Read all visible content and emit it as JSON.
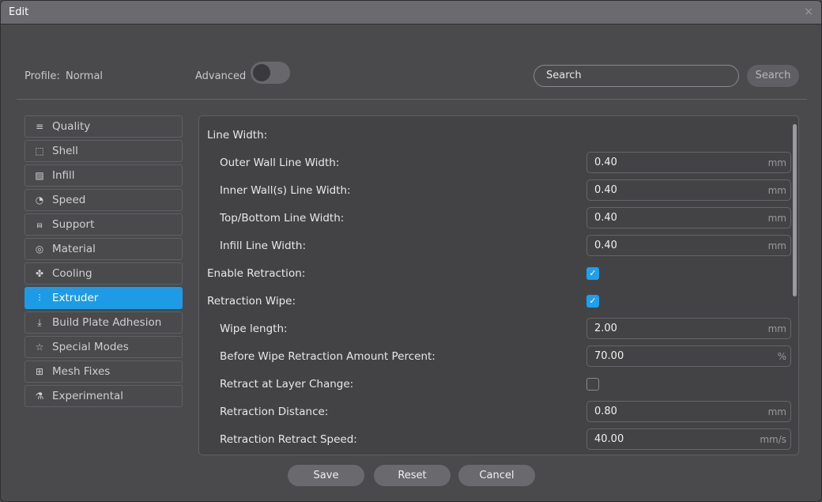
{
  "window": {
    "title": "Edit",
    "close_icon": "×"
  },
  "header": {
    "profile_label": "Profile:",
    "profile_value": "Normal",
    "advanced_label": "Advanced",
    "advanced_on": false,
    "search_placeholder": "Search",
    "search_button": "Search"
  },
  "sidebar": {
    "items": [
      {
        "label": "Quality",
        "icon": "≡"
      },
      {
        "label": "Shell",
        "icon": "⬚"
      },
      {
        "label": "Infill",
        "icon": "▨"
      },
      {
        "label": "Speed",
        "icon": "◔"
      },
      {
        "label": "Support",
        "icon": "⩎"
      },
      {
        "label": "Material",
        "icon": "◎"
      },
      {
        "label": "Cooling",
        "icon": "✤"
      },
      {
        "label": "Extruder",
        "icon": "⫶"
      },
      {
        "label": "Build Plate Adhesion",
        "icon": "⤓"
      },
      {
        "label": "Special Modes",
        "icon": "☆"
      },
      {
        "label": "Mesh Fixes",
        "icon": "⊞"
      },
      {
        "label": "Experimental",
        "icon": "⚗"
      }
    ],
    "active": "Extruder"
  },
  "settings": [
    {
      "label": "Line Width:",
      "type": "header"
    },
    {
      "label": "Outer Wall Line Width:",
      "value": "0.40",
      "unit": "mm"
    },
    {
      "label": "Inner Wall(s) Line Width:",
      "value": "0.40",
      "unit": "mm"
    },
    {
      "label": "Top/Bottom Line Width:",
      "value": "0.40",
      "unit": "mm"
    },
    {
      "label": "Infill Line Width:",
      "value": "0.40",
      "unit": "mm"
    },
    {
      "label": "Enable Retraction:",
      "type": "check",
      "checked": true,
      "check": "✓"
    },
    {
      "label": "Retraction Wipe:",
      "type": "check",
      "checked": true,
      "check": "✓"
    },
    {
      "label": "Wipe length:",
      "value": "2.00",
      "unit": "mm"
    },
    {
      "label": "Before Wipe Retraction Amount Percent:",
      "value": "70.00",
      "unit": "%"
    },
    {
      "label": "Retract at Layer Change:",
      "type": "check",
      "checked": false
    },
    {
      "label": "Retraction Distance:",
      "value": "0.80",
      "unit": "mm"
    },
    {
      "label": "Retraction Retract Speed:",
      "value": "40.00",
      "unit": "mm/s"
    }
  ],
  "footer": {
    "save": "Save",
    "reset": "Reset",
    "cancel": "Cancel"
  },
  "colors": {
    "accent": "#1e9be6",
    "background": "#4a4a4c",
    "titlebar": "#6b6a6f"
  }
}
